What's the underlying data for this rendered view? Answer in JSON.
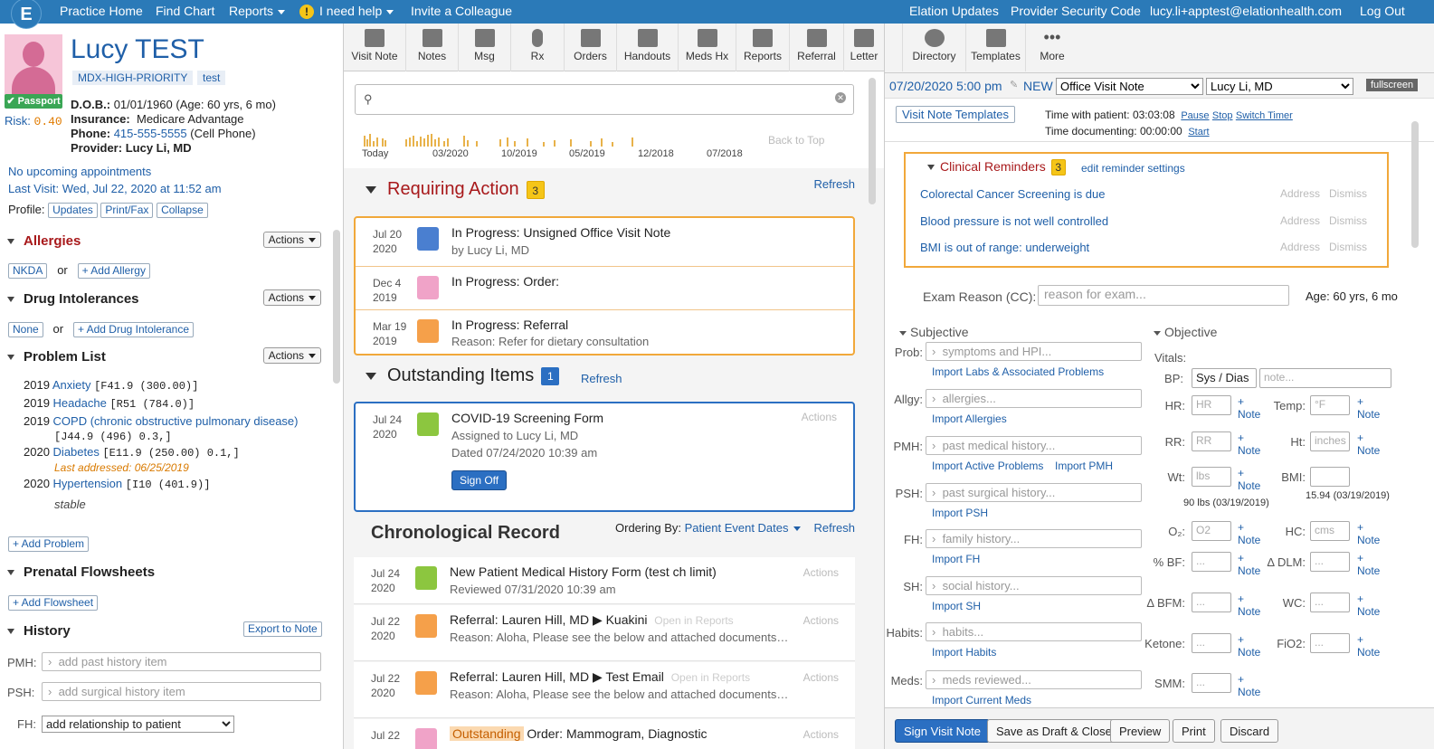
{
  "topbar": {
    "logo": "E",
    "practice_home": "Practice Home",
    "find_chart": "Find Chart",
    "reports": "Reports",
    "help": "I need help",
    "invite": "Invite a Colleague",
    "updates": "Elation Updates",
    "security": "Provider Security Code",
    "email": "lucy.li+apptest@elationhealth.com",
    "logout": "Log Out"
  },
  "patient": {
    "name": "Lucy TEST",
    "tag1": "MDX-HIGH-PRIORITY",
    "tag2": "test",
    "passport": "Passport",
    "risk_label": "Risk:",
    "risk_value": "0.40",
    "dob_label": "D.O.B.:",
    "dob": "01/01/1960 (Age: 60 yrs, 6 mo)",
    "insurance_label": "Insurance:",
    "insurance": "Medicare Advantage",
    "phone_label": "Phone:",
    "phone": "415-555-5555",
    "phone_type": "(Cell Phone)",
    "provider_label": "Provider:",
    "provider": "Lucy Li, MD",
    "appointments": "No upcoming appointments",
    "last_visit": "Last Visit: Wed, Jul 22, 2020 at 11:52 am",
    "profile_label": "Profile:",
    "profile_updates": "Updates",
    "profile_print": "Print/Fax",
    "profile_collapse": "Collapse"
  },
  "left": {
    "allergies": "Allergies",
    "actions": "Actions",
    "nkda": "NKDA",
    "or": "or",
    "add_allergy": "+ Add Allergy",
    "drug_intol": "Drug Intolerances",
    "none": "None",
    "add_drug_intol": "+ Add Drug Intolerance",
    "problem_list": "Problem List",
    "problems": [
      {
        "year": "2019",
        "name": "Anxiety",
        "code": "[F41.9 (300.00)]"
      },
      {
        "year": "2019",
        "name": "Headache",
        "code": "[R51 (784.0)]"
      },
      {
        "year": "2019",
        "name": "COPD (chronic obstructive pulmonary disease)",
        "code": "[J44.9 (496) 0.3,]"
      },
      {
        "year": "2020",
        "name": "Diabetes",
        "code": "[E11.9 (250.00) 0.1,]",
        "note": "Last addressed: 06/25/2019"
      },
      {
        "year": "2020",
        "name": "Hypertension",
        "code": "[I10 (401.9)]",
        "note": "stable"
      }
    ],
    "add_problem": "+ Add Problem",
    "prenatal": "Prenatal Flowsheets",
    "add_flowsheet": "+ Add Flowsheet",
    "history": "History",
    "export_note": "Export to Note",
    "pmh_label": "PMH:",
    "pmh_placeholder": "add past history item",
    "psh_label": "PSH:",
    "psh_placeholder": "add surgical history item",
    "fh_label": "FH:",
    "fh_select": "add relationship to patient"
  },
  "toolbar": [
    {
      "label": "Visit Note",
      "icon": "document-icon"
    },
    {
      "label": "Notes",
      "icon": "notes-icon"
    },
    {
      "label": "Msg",
      "icon": "message-icon"
    },
    {
      "label": "Rx",
      "icon": "pill-icon"
    },
    {
      "label": "Orders",
      "icon": "orders-icon"
    },
    {
      "label": "Handouts",
      "icon": "stack-icon"
    },
    {
      "label": "Meds Hx",
      "icon": "meds-icon"
    },
    {
      "label": "Reports",
      "icon": "clipboard-icon"
    },
    {
      "label": "Referral",
      "icon": "referral-icon"
    },
    {
      "label": "Letter",
      "icon": "envelope-icon"
    },
    {
      "label": "Directory",
      "icon": "directory-icon"
    },
    {
      "label": "Templates",
      "icon": "templates-icon"
    },
    {
      "label": "More",
      "icon": "more-icon"
    }
  ],
  "timeline": {
    "labels": [
      "Today",
      "03/2020",
      "10/2019",
      "05/2019",
      "12/2018",
      "07/2018"
    ],
    "back_to_top": "Back to Top"
  },
  "requiring": {
    "title": "Requiring Action",
    "count": "3",
    "refresh": "Refresh",
    "items": [
      {
        "month": "Jul 20",
        "year": "2020",
        "title": "In Progress: Unsigned Office Visit Note",
        "sub": "by Lucy Li, MD",
        "color": "#4a7fd0"
      },
      {
        "month": "Dec 4",
        "year": "2019",
        "title": "In Progress: Order:",
        "sub": "",
        "color": "#f0a3c8"
      },
      {
        "month": "Mar 19",
        "year": "2019",
        "title": "In Progress: Referral",
        "sub": "Reason: Refer for dietary consultation",
        "color": "#f5a04a"
      }
    ]
  },
  "outstanding": {
    "title": "Outstanding Items",
    "count": "1",
    "refresh": "Refresh",
    "month": "Jul 24",
    "year": "2020",
    "item_title": "COVID-19 Screening Form",
    "assigned": "Assigned to Lucy Li, MD",
    "dated": "Dated 07/24/2020 10:39 am",
    "actions": "Actions",
    "signoff": "Sign Off"
  },
  "chrono": {
    "title": "Chronological Record",
    "ordering_label": "Ordering By:",
    "ordering_value": "Patient Event Dates",
    "refresh": "Refresh",
    "items": [
      {
        "month": "Jul 24",
        "year": "2020",
        "title": "New Patient Medical History Form (test ch limit)",
        "sub": "Reviewed 07/31/2020 10:39 am",
        "color": "#8cc63f"
      },
      {
        "month": "Jul 22",
        "year": "2020",
        "title": "Referral: Lauren Hill, MD ▶ Kuakini",
        "extra": "Open in Reports",
        "sub": "Reason: Aloha, Please see the below and attached documents…",
        "color": "#f5a04a"
      },
      {
        "month": "Jul 22",
        "year": "2020",
        "title": "Referral: Lauren Hill, MD ▶ Test Email",
        "extra": "Open in Reports",
        "sub": "Reason: Aloha, Please see the below and attached documents…",
        "color": "#f5a04a"
      },
      {
        "month": "Jul 22",
        "year": "",
        "title": "Order: Mammogram, Diagnostic",
        "tag": "Outstanding",
        "sub": "",
        "color": "#f0a3c8"
      }
    ],
    "actions": "Actions"
  },
  "visit": {
    "datetime": "07/20/2020 5:00 pm",
    "new": "NEW",
    "note_type": "Office Visit Note",
    "provider": "Lucy Li, MD",
    "fullscreen": "fullscreen",
    "templates": "Visit Note Templates",
    "time_with_label": "Time with patient:",
    "time_with": "03:03:08",
    "pause": "Pause",
    "stop": "Stop",
    "switch_timer": "Switch Timer",
    "time_doc_label": "Time documenting:",
    "time_doc": "00:00:00",
    "start": "Start",
    "reminders_title": "Clinical Reminders",
    "reminders_count": "3",
    "edit_reminders": "edit reminder settings",
    "reminders": [
      "Colorectal Cancer Screening is due",
      "Blood pressure is not well controlled",
      "BMI is out of range: underweight"
    ],
    "address": "Address",
    "dismiss": "Dismiss",
    "exam_reason_label": "Exam Reason (CC):",
    "exam_reason_placeholder": "reason for exam...",
    "age": "Age: 60 yrs, 6 mo",
    "subjective": "Subjective",
    "objective": "Objective",
    "fields": [
      {
        "label": "Prob:",
        "placeholder": "symptoms and HPI...",
        "link": "Import Labs & Associated Problems"
      },
      {
        "label": "Allgy:",
        "placeholder": "allergies...",
        "link": "Import Allergies"
      },
      {
        "label": "PMH:",
        "placeholder": "past medical history...",
        "link": "Import Active Problems",
        "link2": "Import PMH"
      },
      {
        "label": "PSH:",
        "placeholder": "past surgical history...",
        "link": "Import PSH"
      },
      {
        "label": "FH:",
        "placeholder": "family history...",
        "link": "Import FH"
      },
      {
        "label": "SH:",
        "placeholder": "social history...",
        "link": "Import SH"
      },
      {
        "label": "Habits:",
        "placeholder": "habits...",
        "link": "Import Habits"
      },
      {
        "label": "Meds:",
        "placeholder": "meds reviewed...",
        "link": "Import Current Meds"
      }
    ],
    "vitals_label": "Vitals:",
    "bp_label": "BP:",
    "bp_value": "Sys / Dias",
    "bp_note": "note...",
    "vitals": [
      {
        "l1": "HR:",
        "p1": "HR",
        "l2": "Temp:",
        "p2": "°F"
      },
      {
        "l1": "RR:",
        "p1": "RR",
        "l2": "Ht:",
        "p2": "inches"
      },
      {
        "l1": "Wt:",
        "p1": "lbs",
        "l2": "BMI:",
        "p2": ""
      },
      {
        "l1": "O₂:",
        "p1": "O2",
        "l2": "HC:",
        "p2": "cms"
      },
      {
        "l1": "% BF:",
        "p1": "...",
        "l2": "Δ DLM:",
        "p2": "..."
      },
      {
        "l1": "Δ BFM:",
        "p1": "...",
        "l2": "WC:",
        "p2": "..."
      },
      {
        "l1": "Ketone:",
        "p1": "...",
        "l2": "FiO2:",
        "p2": "..."
      },
      {
        "l1": "SMM:",
        "p1": "...",
        "l2": "",
        "p2": ""
      }
    ],
    "wt_prev": "90 lbs (03/19/2019)",
    "bmi_prev": "15.94 (03/19/2019)",
    "plus": "+",
    "note": "Note",
    "sign": "Sign Visit Note",
    "save_draft": "Save as Draft & Close",
    "preview": "Preview",
    "print": "Print",
    "discard": "Discard"
  }
}
